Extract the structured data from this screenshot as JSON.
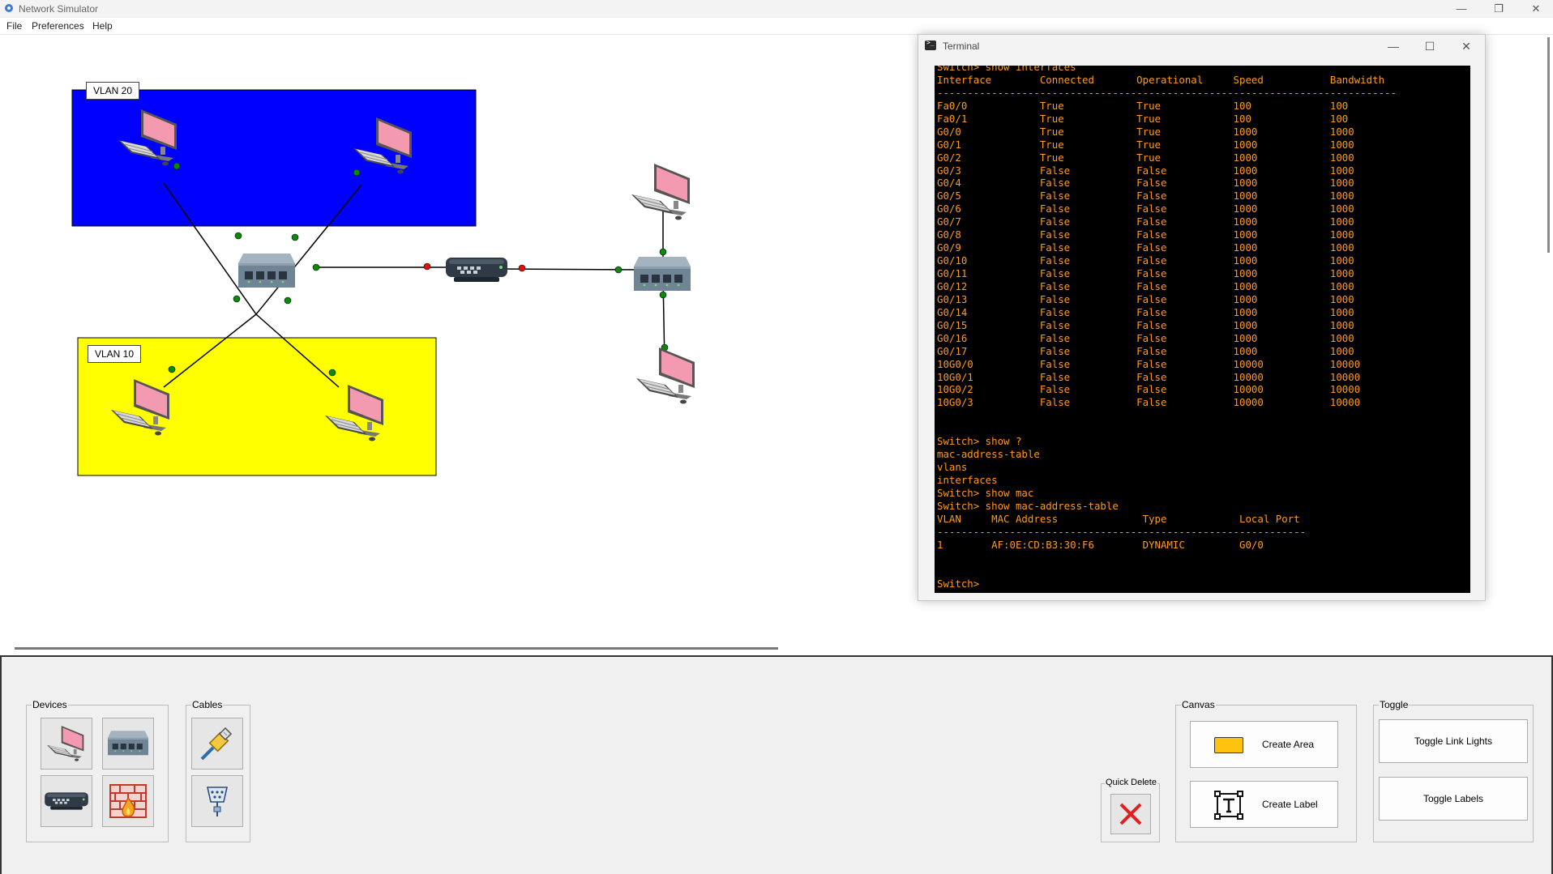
{
  "window": {
    "title": "Network Simulator",
    "minimize": "—",
    "restore": "❐",
    "close": "✕"
  },
  "menu": [
    "File",
    "Preferences",
    "Help"
  ],
  "canvas": {
    "areas": [
      {
        "label": "VLAN 20",
        "color": "#0000ff"
      },
      {
        "label": "VLAN 10",
        "color": "#ffff00"
      }
    ],
    "link_light_colors": {
      "up": "#0a8a0a",
      "down": "#e01010"
    },
    "devices": [
      "pc",
      "pc",
      "pc",
      "pc",
      "pc",
      "pc",
      "switch",
      "switch",
      "router"
    ]
  },
  "terminal": {
    "title": "Terminal",
    "lines": [
      "Switch> show interfaces",
      "Interface        Connected       Operational     Speed           Bandwidth",
      "----------------------------------------------------------------------------",
      "Fa0/0            True            True            100             100",
      "Fa0/1            True            True            100             100",
      "G0/0             True            True            1000            1000",
      "G0/1             True            True            1000            1000",
      "G0/2             True            True            1000            1000",
      "G0/3             False           False           1000            1000",
      "G0/4             False           False           1000            1000",
      "G0/5             False           False           1000            1000",
      "G0/6             False           False           1000            1000",
      "G0/7             False           False           1000            1000",
      "G0/8             False           False           1000            1000",
      "G0/9             False           False           1000            1000",
      "G0/10            False           False           1000            1000",
      "G0/11            False           False           1000            1000",
      "G0/12            False           False           1000            1000",
      "G0/13            False           False           1000            1000",
      "G0/14            False           False           1000            1000",
      "G0/15            False           False           1000            1000",
      "G0/16            False           False           1000            1000",
      "G0/17            False           False           1000            1000",
      "10G0/0           False           False           10000           10000",
      "10G0/1           False           False           10000           10000",
      "10G0/2           False           False           10000           10000",
      "10G0/3           False           False           10000           10000",
      "",
      "",
      "Switch> show ?",
      "mac-address-table",
      "vlans",
      "interfaces",
      "Switch> show mac",
      "Switch> show mac-address-table",
      "VLAN     MAC Address              Type            Local Port",
      "-------------------------------------------------------------",
      "1        AF:0E:CD:B3:30:F6        DYNAMIC         G0/0",
      "",
      "",
      "Switch>"
    ]
  },
  "toolbar": {
    "devices_title": "Devices",
    "cables_title": "Cables",
    "quick_delete_title": "Quick Delete",
    "canvas_title": "Canvas",
    "toggle_title": "Toggle",
    "create_area": "Create Area",
    "create_label": "Create Label",
    "toggle_link_lights": "Toggle Link Lights",
    "toggle_labels": "Toggle Labels",
    "area_swatch_color": "#ffc20e"
  }
}
